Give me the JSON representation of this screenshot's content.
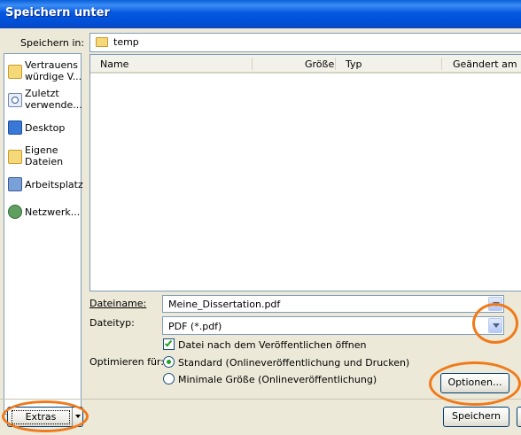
{
  "window": {
    "title": "Speichern unter"
  },
  "save_in": {
    "label": "Speichern in:",
    "folder": "temp"
  },
  "places": [
    {
      "label": "Vertrauens\nwürdige V...",
      "icon": "folder-icon"
    },
    {
      "label": "Zuletzt\nverwende...",
      "icon": "recent-icon"
    },
    {
      "label": "Desktop",
      "icon": "desktop-icon"
    },
    {
      "label": "Eigene\nDateien",
      "icon": "folder-icon"
    },
    {
      "label": "Arbeitsplatz",
      "icon": "computer-icon"
    },
    {
      "label": "Netzwerk...",
      "icon": "network-icon"
    }
  ],
  "file_list": {
    "columns": [
      "Name",
      "Größe",
      "Typ",
      "Geändert am"
    ],
    "rows": []
  },
  "filename": {
    "label": "Dateiname:",
    "value": "Meine_Dissertation.pdf"
  },
  "filetype": {
    "label": "Dateityp:",
    "value": "PDF (*.pdf)"
  },
  "open_after_publish": {
    "label": "Datei nach dem Veröffentlichen öffnen",
    "checked": true
  },
  "optimize": {
    "label": "Optimieren für:",
    "options": [
      {
        "label": "Standard (Onlineveröffentlichung und Drucken)",
        "selected": true
      },
      {
        "label": "Minimale Größe (Onlineveröffentlichung)",
        "selected": false
      }
    ]
  },
  "buttons": {
    "options": "Optionen...",
    "tools": "Extras",
    "save": "Speichern"
  },
  "highlight_color": "#f07a1a"
}
